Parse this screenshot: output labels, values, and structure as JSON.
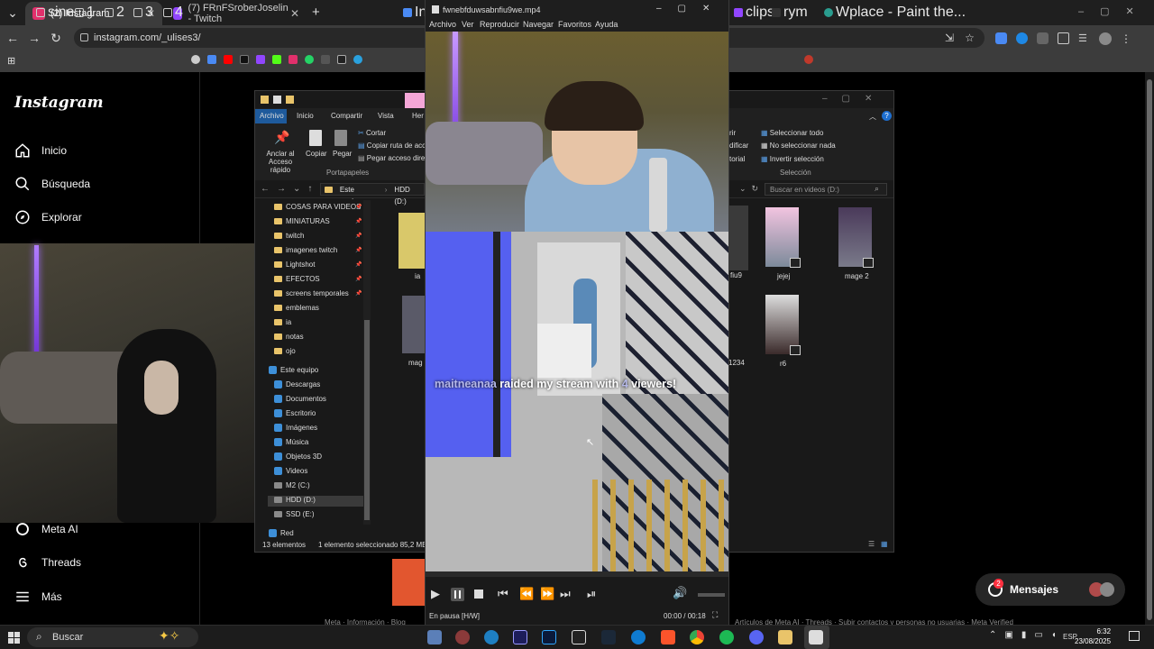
{
  "browser": {
    "tabs": [
      {
        "title": "(2) Instagram",
        "active": true,
        "icon": "instagram-icon",
        "color": "#e1306c"
      },
      {
        "title": "(7) FRnFSroberJoselin - Twitch",
        "active": false,
        "icon": "twitch-icon",
        "color": "#9146ff"
      }
    ],
    "url": "instagram.com/_ulises3/",
    "bookmarks": [
      {
        "label": "sine",
        "icon": "folder-icon"
      },
      {
        "label": "1",
        "icon": "folder-icon"
      },
      {
        "label": "2",
        "icon": "folder-icon"
      },
      {
        "label": "3",
        "icon": "folder-icon"
      },
      {
        "label": "4",
        "icon": "folder-icon"
      },
      {
        "label": "Ini",
        "icon": "bookmark-icon"
      },
      {
        "label": "clips",
        "icon": "twitch-icon"
      },
      {
        "label": "rym",
        "icon": "bookmark-icon"
      },
      {
        "label": "Wplace - Paint the...",
        "icon": "globe-icon"
      }
    ]
  },
  "instagram": {
    "logo": "Instagram",
    "nav": [
      {
        "label": "Inicio",
        "icon": "home-icon"
      },
      {
        "label": "Búsqueda",
        "icon": "search-icon"
      },
      {
        "label": "Explorar",
        "icon": "compass-icon"
      }
    ],
    "nav_bottom": [
      {
        "label": "Meta AI",
        "icon": "meta-ai-icon"
      },
      {
        "label": "Threads",
        "icon": "threads-icon"
      },
      {
        "label": "Más",
        "icon": "menu-icon"
      }
    ],
    "messages_label": "Mensajes",
    "messages_badge": "2",
    "footer_left": "Meta · Información · Blog",
    "footer_right": "Artículos de Meta AI · Threads · Subir contactos y personas no usuarias · Meta Verified"
  },
  "explorer": {
    "ribbon_tabs": [
      "Archivo",
      "Inicio",
      "Compartir",
      "Vista",
      "Her"
    ],
    "clipboard": {
      "pin": "Anclar al Acceso rápido",
      "copy": "Copiar",
      "paste": "Pegar",
      "cut": "Cortar",
      "copy_path": "Copiar ruta de acc",
      "paste_shortcut": "Pegar acceso direc",
      "group": "Portapapeles"
    },
    "select": {
      "all": "Seleccionar todo",
      "none": "No seleccionar nada",
      "invert": "Invertir selección",
      "group": "Selección"
    },
    "partial_right": [
      "rir",
      "dificar",
      "torial"
    ],
    "breadcrumb": [
      "Este equipo",
      "HDD (D:)"
    ],
    "search_placeholder": "Buscar en videos (D:)",
    "quick_access": [
      "COSAS PARA VIDEOS",
      "MINIATURAS",
      "twitch",
      "imagenes twitch",
      "Lightshot",
      "EFECTOS",
      "screens temporales",
      "emblemas",
      "ia",
      "notas",
      "ojo"
    ],
    "this_pc": "Este equipo",
    "pc_items": [
      "Descargas",
      "Documentos",
      "Escritorio",
      "Imágenes",
      "Música",
      "Objetos 3D",
      "Videos",
      "M2 (C:)",
      "HDD (D:)",
      "SSD (E:)"
    ],
    "network": "Red",
    "files": [
      {
        "label": "ia"
      },
      {
        "label": "mag"
      },
      {
        "label": "fiu9"
      },
      {
        "label": "1234"
      },
      {
        "label": "jejej"
      },
      {
        "label": "mage 2"
      },
      {
        "label": "r6"
      }
    ],
    "status_count": "13 elementos",
    "status_selected": "1 elemento seleccionado  85,2 MB"
  },
  "player": {
    "title": "fwnebfduwsabnfiu9we.mp4",
    "menu": [
      "Archivo",
      "Ver",
      "Reproducir",
      "Navegar",
      "Favoritos",
      "Ayuda"
    ],
    "overlay_text_user": "maitneanaa",
    "overlay_text_mid": " raided my stream with ",
    "overlay_text_count": "4",
    "overlay_text_end": " viewers!",
    "status": "En pausa [H/W]",
    "time": "00:00 / 00:18"
  },
  "taskbar": {
    "search": "Buscar",
    "lang": "ESP",
    "time": "6:32",
    "date": "23/08/2025"
  }
}
